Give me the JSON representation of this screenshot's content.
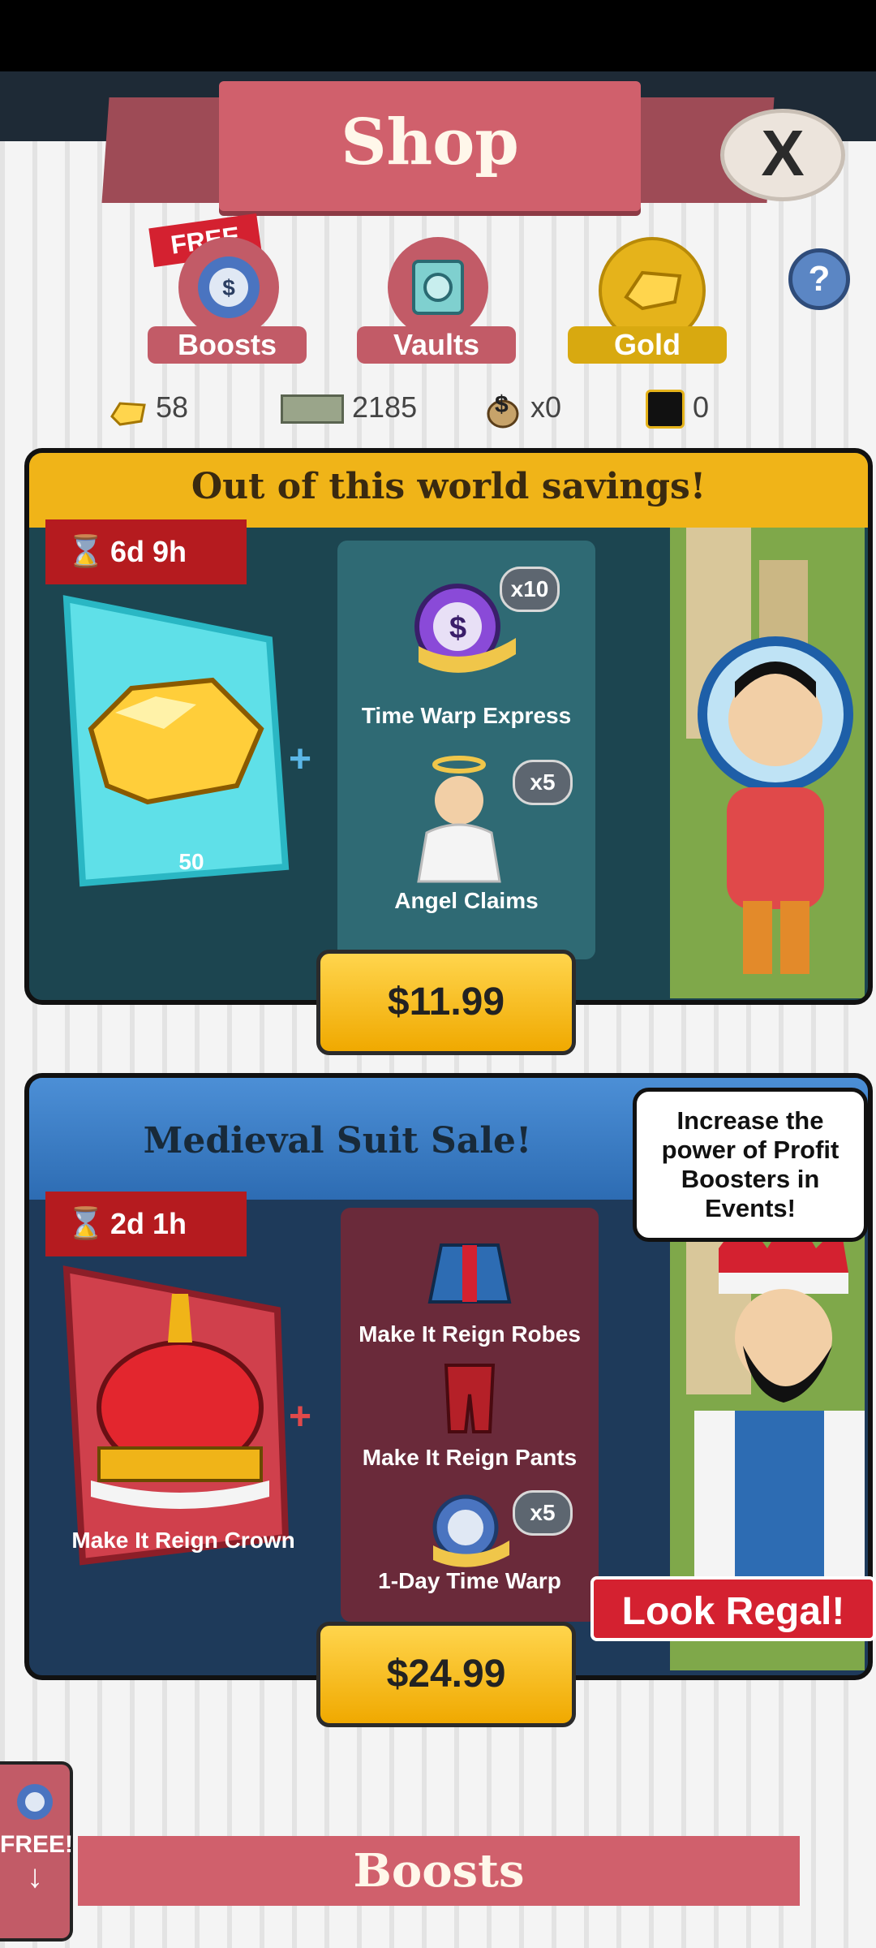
{
  "shop": {
    "title": "Shop",
    "close_label": "X",
    "help_label": "?"
  },
  "tabs": [
    {
      "label": "Boosts",
      "badge": "FREE"
    },
    {
      "label": "Vaults"
    },
    {
      "label": "Gold"
    }
  ],
  "currencies": [
    {
      "icon": "gold-icon",
      "value": "58"
    },
    {
      "icon": "megabucks-icon",
      "value": "2185"
    },
    {
      "icon": "money-bag-icon",
      "value": "x0"
    },
    {
      "icon": "megaticket-icon",
      "value": "0"
    }
  ],
  "offer1": {
    "title": "Out of this world savings!",
    "timer": "6d 9h",
    "gold_amount": "50",
    "items": [
      {
        "name": "Time Warp Express",
        "qty": "x10"
      },
      {
        "name": "Angel Claims",
        "qty": "x5"
      }
    ],
    "price": "$11.99"
  },
  "offer2": {
    "title": "Medieval Suit Sale!",
    "timer": "2d 1h",
    "main_item": "Make It Reign Crown",
    "items": [
      {
        "name": "Make It Reign Robes",
        "qty": ""
      },
      {
        "name": "Make It Reign Pants",
        "qty": ""
      },
      {
        "name": "1-Day Time Warp",
        "qty": "x5"
      }
    ],
    "speech": "Increase the power of Profit Boosters in Events!",
    "badge": "Look Regal!",
    "price": "$24.99"
  },
  "side_free": {
    "label": "FREE!",
    "arrow": "↓"
  },
  "boosts_section": {
    "title": "Boosts"
  },
  "colors": {
    "accent_pink": "#d0606c",
    "gold": "#f0b418",
    "price": "#ffd54d"
  }
}
